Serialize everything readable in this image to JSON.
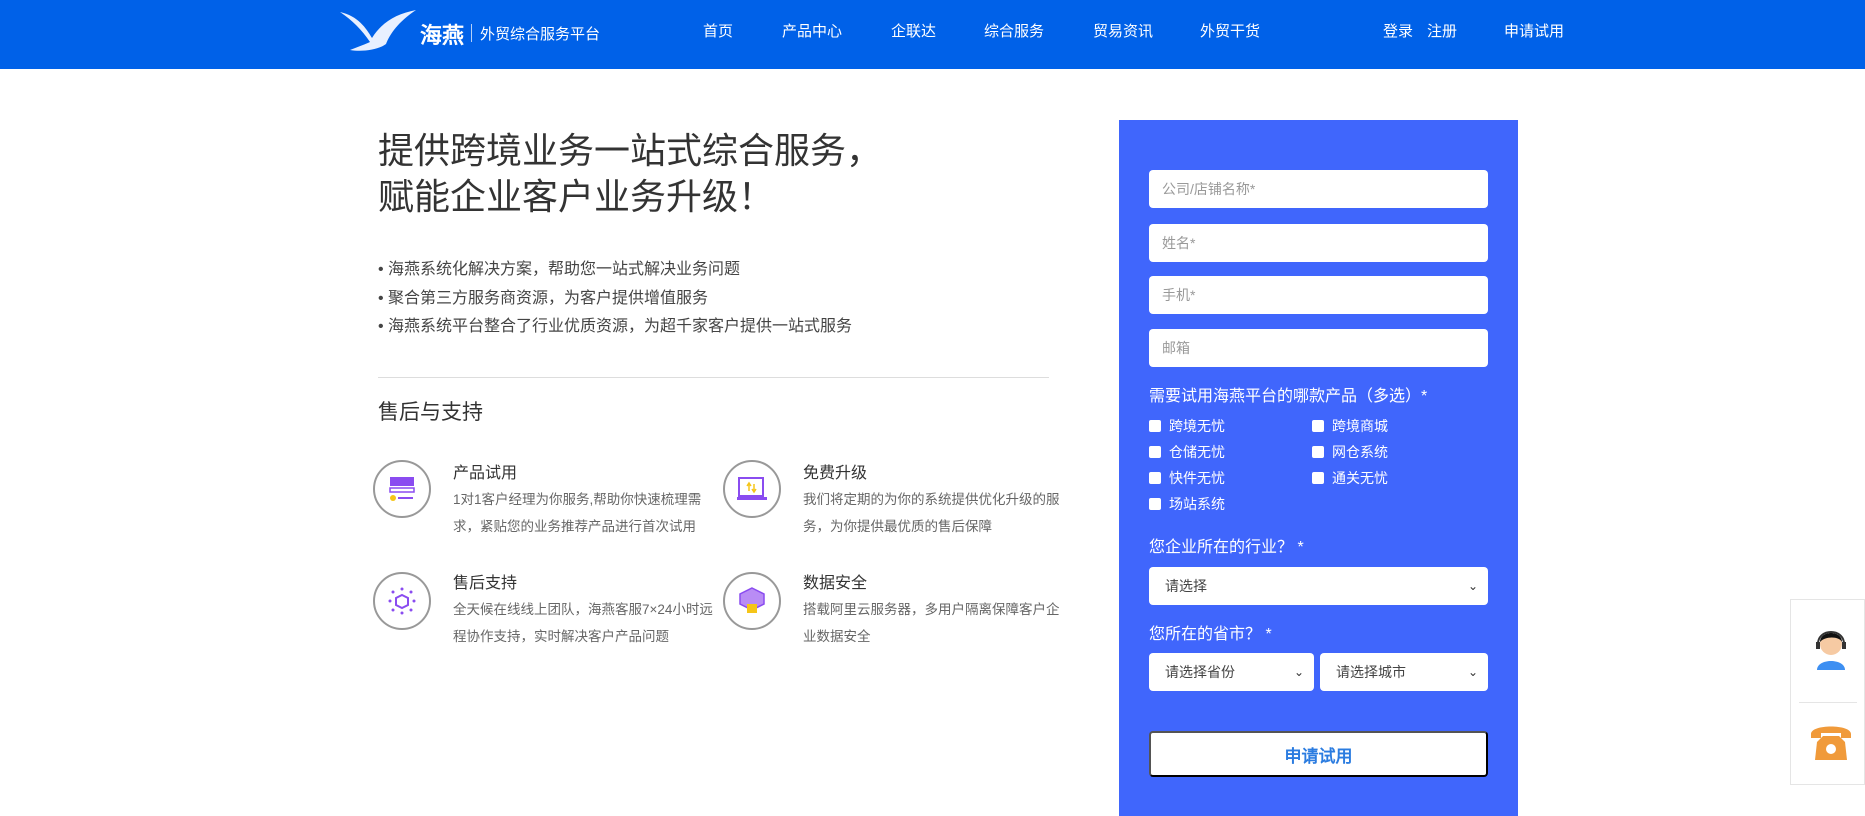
{
  "header": {
    "logo_name": "海燕",
    "logo_sub": "外贸综合服务平台",
    "nav": [
      "首页",
      "产品中心",
      "企联达",
      "综合服务",
      "贸易资讯",
      "外贸干货"
    ],
    "login": "登录",
    "register": "注册",
    "trial": "申请试用"
  },
  "hero": {
    "line1": "提供跨境业务一站式综合服务，",
    "line2": "赋能企业客户业务升级！",
    "bullets": [
      "• 海燕系统化解决方案，帮助您一站式解决业务问题",
      "• 聚合第三方服务商资源，为客户提供增值服务",
      "• 海燕系统平台整合了行业优质资源，为超千家客户提供一站式服务"
    ]
  },
  "support": {
    "title": "售后与支持",
    "features": [
      {
        "title": "产品试用",
        "desc": "1对1客户经理为你服务,帮助你快速梳理需求，紧贴您的业务推荐产品进行首次试用"
      },
      {
        "title": "免费升级",
        "desc": "我们将定期的为你的系统提供优化升级的服务，为你提供最优质的售后保障"
      },
      {
        "title": "售后支持",
        "desc": "全天候在线线上团队，海燕客服7×24小时远程协作支持，实时解决客户产品问题"
      },
      {
        "title": "数据安全",
        "desc": "搭载阿里云服务器，多用户隔离保障客户企业数据安全"
      }
    ]
  },
  "form": {
    "company": "公司/店铺名称*",
    "name": "姓名*",
    "phone": "手机*",
    "email": "邮箱",
    "products_label": "需要试用海燕平台的哪款产品（多选）*",
    "products": [
      "跨境无忧",
      "跨境商城",
      "仓储无忧",
      "网仓系统",
      "快件无忧",
      "通关无忧",
      "场站系统"
    ],
    "industry_label": "您企业所在的行业？ *",
    "industry_value": "请选择",
    "region_label": "您所在的省市？ *",
    "province_value": "请选择省份",
    "city_value": "请选择城市",
    "submit": "申请试用"
  }
}
